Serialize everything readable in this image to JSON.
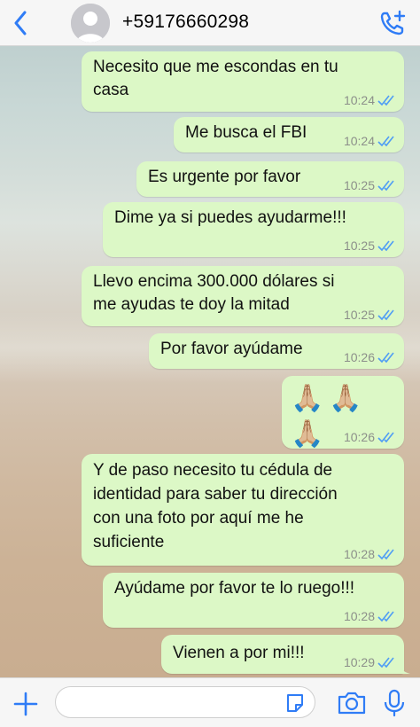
{
  "header": {
    "contact_name": "+59176660298"
  },
  "messages": [
    {
      "text": "Necesito que me escondas en tu\ncasa",
      "time": "10:24",
      "status": "read"
    },
    {
      "text": "Me busca el FBI",
      "time": "10:24",
      "status": "read"
    },
    {
      "text": "Es urgente por favor",
      "time": "10:25",
      "status": "read"
    },
    {
      "text": "Dime ya si puedes ayudarme!!!",
      "time": "10:25",
      "status": "read"
    },
    {
      "text": "Llevo encima 300.000 dólares si\nme ayudas te doy la mitad",
      "time": "10:25",
      "status": "read"
    },
    {
      "text": "Por favor ayúdame",
      "time": "10:26",
      "status": "read"
    },
    {
      "text": "🙏🏼🙏🏼🙏🏼",
      "time": "10:26",
      "status": "read"
    },
    {
      "text": "Y de paso necesito tu cédula de\nidentidad para saber tu dirección\ncon una foto por aquí me he\nsuficiente",
      "time": "10:28",
      "status": "read"
    },
    {
      "text": "Ayúdame por favor te lo ruego!!!",
      "time": "10:28",
      "status": "read"
    },
    {
      "text": "Vienen a por mi!!!",
      "time": "10:29",
      "status": "read"
    }
  ],
  "input": {
    "placeholder": ""
  },
  "colors": {
    "accent": "#2f7cf6",
    "bubble_outgoing": "#dcf8c6",
    "read_ticks": "#4f9df5",
    "timestamp": "#8c8f8a"
  },
  "icons": [
    "back-chevron-icon",
    "avatar-placeholder-icon",
    "add-call-icon",
    "plus-icon",
    "sticker-icon",
    "camera-icon",
    "microphone-icon",
    "double-check-icon"
  ]
}
